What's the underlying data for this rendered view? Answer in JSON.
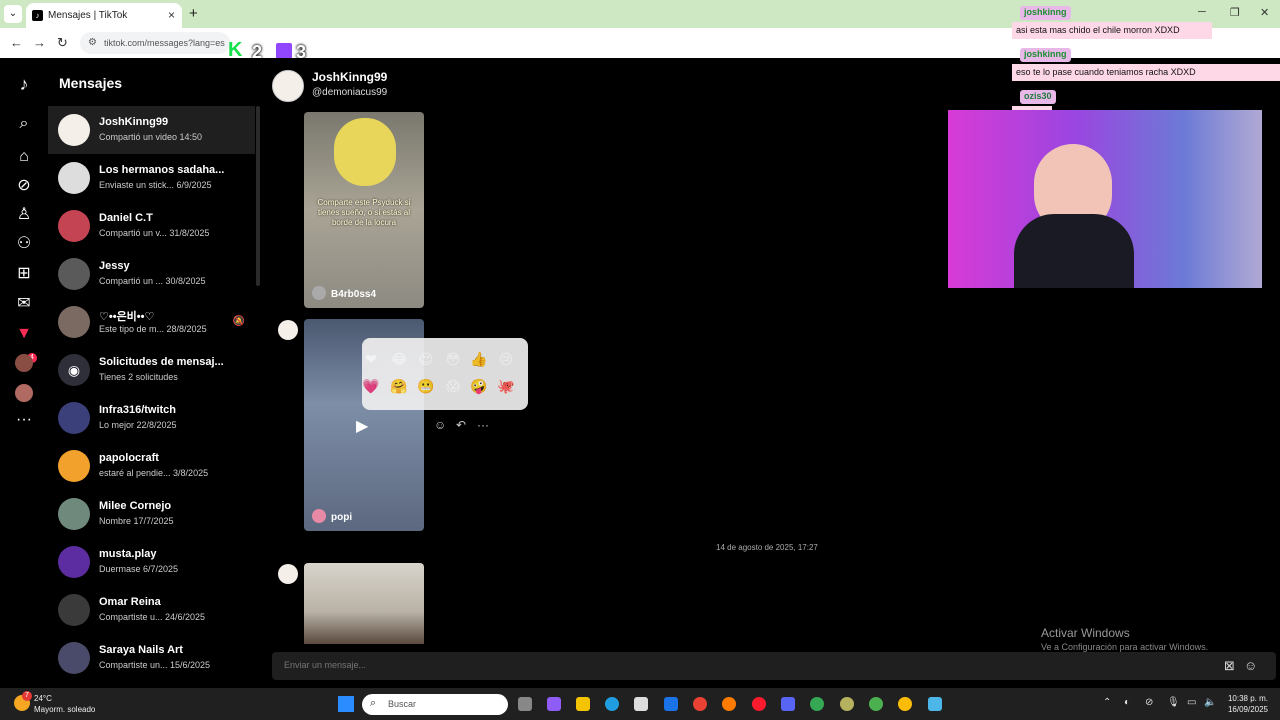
{
  "browser": {
    "tab_title": "Mensajes | TikTok",
    "url": "tiktok.com/messages?lang=es",
    "overlay_counts": [
      "2",
      "3"
    ]
  },
  "stream_chat": {
    "messages": [
      {
        "user": "joshkinng",
        "text": "asi esta mas chido el chile morron XDXD"
      },
      {
        "user": "joshkinng",
        "text": "eso te lo pase cuando teniamos racha XDXD"
      },
      {
        "user": "ozis30",
        "text": ""
      }
    ]
  },
  "sidebar": {
    "title": "Mensajes"
  },
  "conversations": [
    {
      "name": "JoshKinng99",
      "sub": "Compartió un video 14:50"
    },
    {
      "name": "Los hermanos sadaha...",
      "sub": "Enviaste un stick... 6/9/2025"
    },
    {
      "name": "Daniel C.T",
      "sub": "Compartió un v... 31/8/2025"
    },
    {
      "name": "Jessy",
      "sub": "Compartió un ... 30/8/2025"
    },
    {
      "name": "♡••은비••♡",
      "sub": "Este tipo de m... 28/8/2025"
    },
    {
      "name": "Solicitudes de mensaj...",
      "sub": "Tienes 2 solicitudes"
    },
    {
      "name": "Infra316/twitch",
      "sub": "Lo mejor 22/8/2025"
    },
    {
      "name": "papolocraft",
      "sub": "estaré al pendie... 3/8/2025"
    },
    {
      "name": "Milee Cornejo",
      "sub": "Nombre 17/7/2025"
    },
    {
      "name": "musta.play",
      "sub": "Duermase 6/7/2025"
    },
    {
      "name": "Omar Reina",
      "sub": "Compartiste u... 24/6/2025"
    },
    {
      "name": "Saraya Nails Art",
      "sub": "Compartiste un... 15/6/2025"
    }
  ],
  "chat": {
    "name": "JoshKinng99",
    "handle": "@demoniacus99",
    "videos": [
      {
        "author": "B4rb0ss4",
        "caption": "Comparte este Psyduck si tienes sueño, o si estás al borde de la locura"
      },
      {
        "author": "popi"
      }
    ],
    "date_separator": "14 de agosto de 2025, 17:27",
    "composer_placeholder": "Enviar un mensaje..."
  },
  "emoji_reactions": [
    "❤",
    "😂",
    "😍",
    "😳",
    "👍",
    "😢",
    "💗",
    "🤗",
    "😬",
    "😱",
    "🤪",
    "🐙"
  ],
  "activate_windows": {
    "title": "Activar Windows",
    "sub": "Ve a Configuración para activar Windows."
  },
  "taskbar": {
    "weather_badge": "7",
    "temp": "24°C",
    "weather": "Mayorm. soleado",
    "search_placeholder": "Buscar",
    "time": "10:38 p. m.",
    "date": "16/09/2025"
  },
  "colors": {
    "tiktok_red": "#fe2c55",
    "tab_bar": "#cde8c2",
    "active_row": "#1f1f1f"
  }
}
